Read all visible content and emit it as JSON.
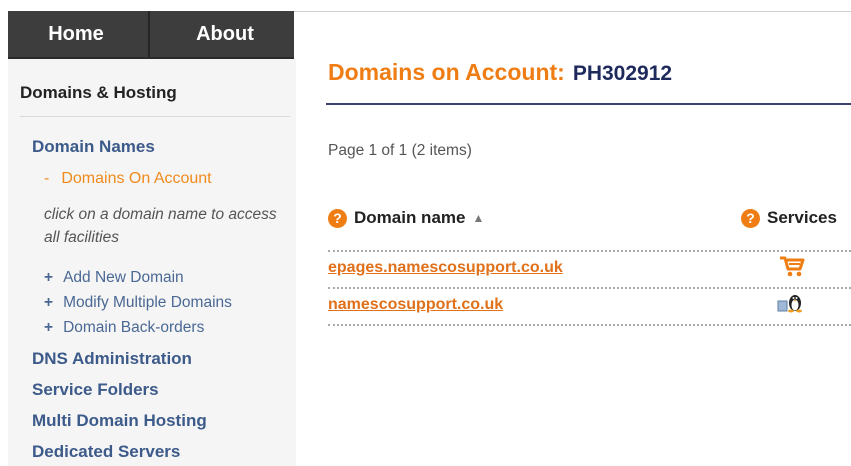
{
  "nav": {
    "tabs": [
      {
        "label": "Home"
      },
      {
        "label": "About"
      }
    ]
  },
  "sidebar": {
    "section_title": "Domains & Hosting",
    "domain_names": "Domain Names",
    "domains_on_account": "Domains On Account",
    "note": "click on a domain name to access all facilities",
    "sub_links": [
      "Add New Domain",
      "Modify Multiple Domains",
      "Domain Back-orders"
    ],
    "links": [
      "DNS Administration",
      "Service Folders",
      "Multi Domain Hosting",
      "Dedicated Servers"
    ]
  },
  "main": {
    "title": "Domains on Account:",
    "account_id": "PH302912",
    "pager": "Page 1 of 1 (2 items)",
    "columns": [
      {
        "label": "Domain name",
        "help_icon": "question-mark-icon",
        "sort_icon": "sort-up-icon"
      },
      {
        "label": "Services",
        "help_icon": "question-mark-icon"
      }
    ],
    "rows": [
      {
        "domain": "epages.namescosupport.co.uk",
        "service_icon": "shopping-cart-icon"
      },
      {
        "domain": "namescosupport.co.uk",
        "service_icon": "linux-hosting-icon"
      }
    ]
  },
  "colors": {
    "accent_orange": "#ef7d13",
    "link_blue": "#3c5a8a",
    "nav_dark": "#3d3d3d",
    "title_navy": "#1f2a5c"
  }
}
